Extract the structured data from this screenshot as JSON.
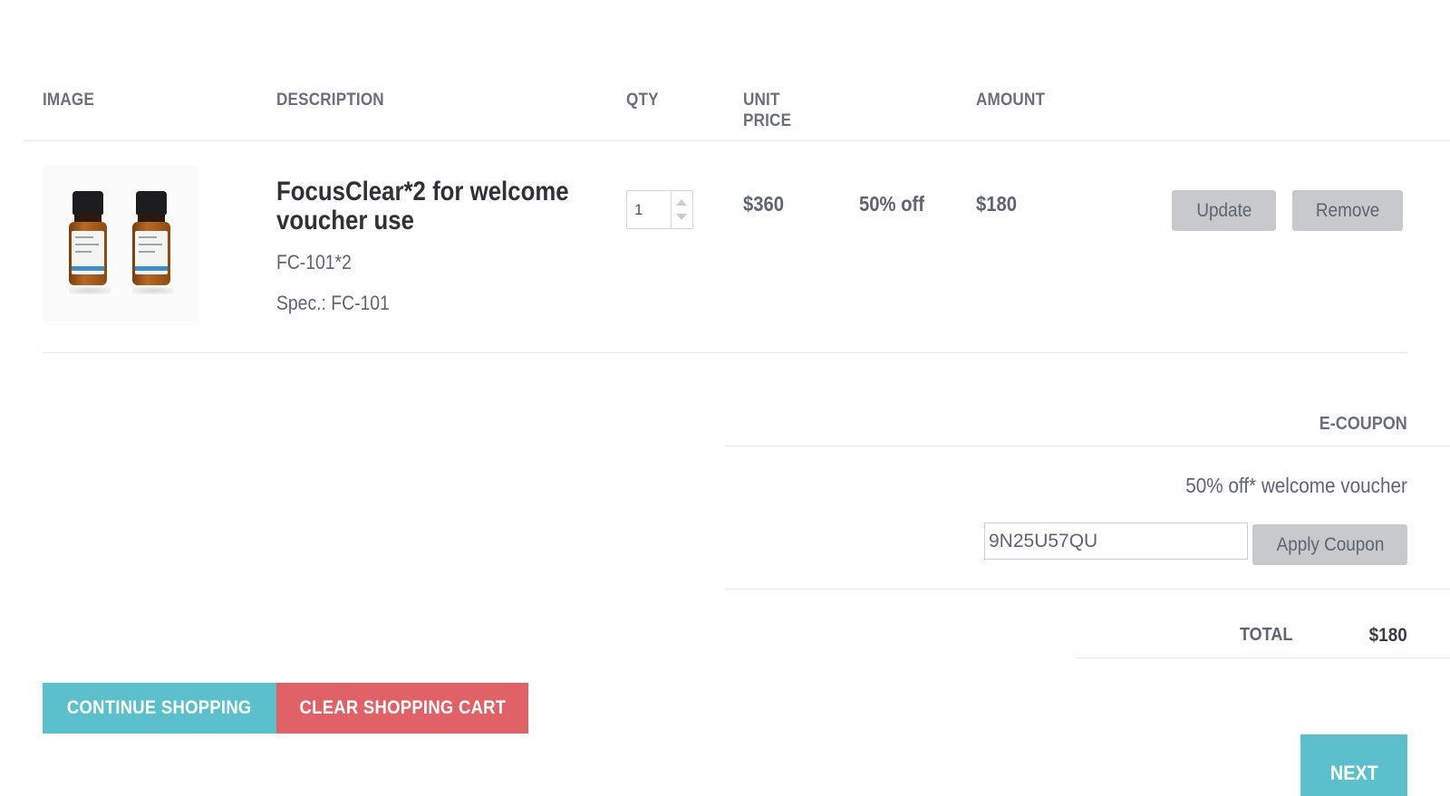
{
  "table": {
    "headers": {
      "image": "IMAGE",
      "description": "DESCRIPTION",
      "qty": "QTY",
      "unit_price_line1": "UNIT",
      "unit_price_line2": "PRICE",
      "amount": "AMOUNT"
    },
    "item": {
      "title": "FocusClear*2 for welcome voucher use",
      "sku": "FC-101*2",
      "spec": "Spec.: FC-101",
      "qty": "1",
      "unit_price": "$360",
      "discount": "50% off",
      "amount": "$180",
      "update_label": "Update",
      "remove_label": "Remove"
    }
  },
  "coupon": {
    "heading": "E-COUPON",
    "voucher_text": "50% off* welcome voucher",
    "code": "9N25U57QU",
    "apply_label": "Apply Coupon"
  },
  "summary": {
    "total_label": "TOTAL",
    "total_value": "$180"
  },
  "actions": {
    "continue_label": "CONTINUE SHOPPING",
    "clear_label": "CLEAR SHOPPING CART",
    "next_label": "NEXT"
  },
  "colors": {
    "teal": "#5bbfcc",
    "red": "#e06266",
    "gray_button": "#c8c9cb",
    "text": "#5d6472"
  }
}
